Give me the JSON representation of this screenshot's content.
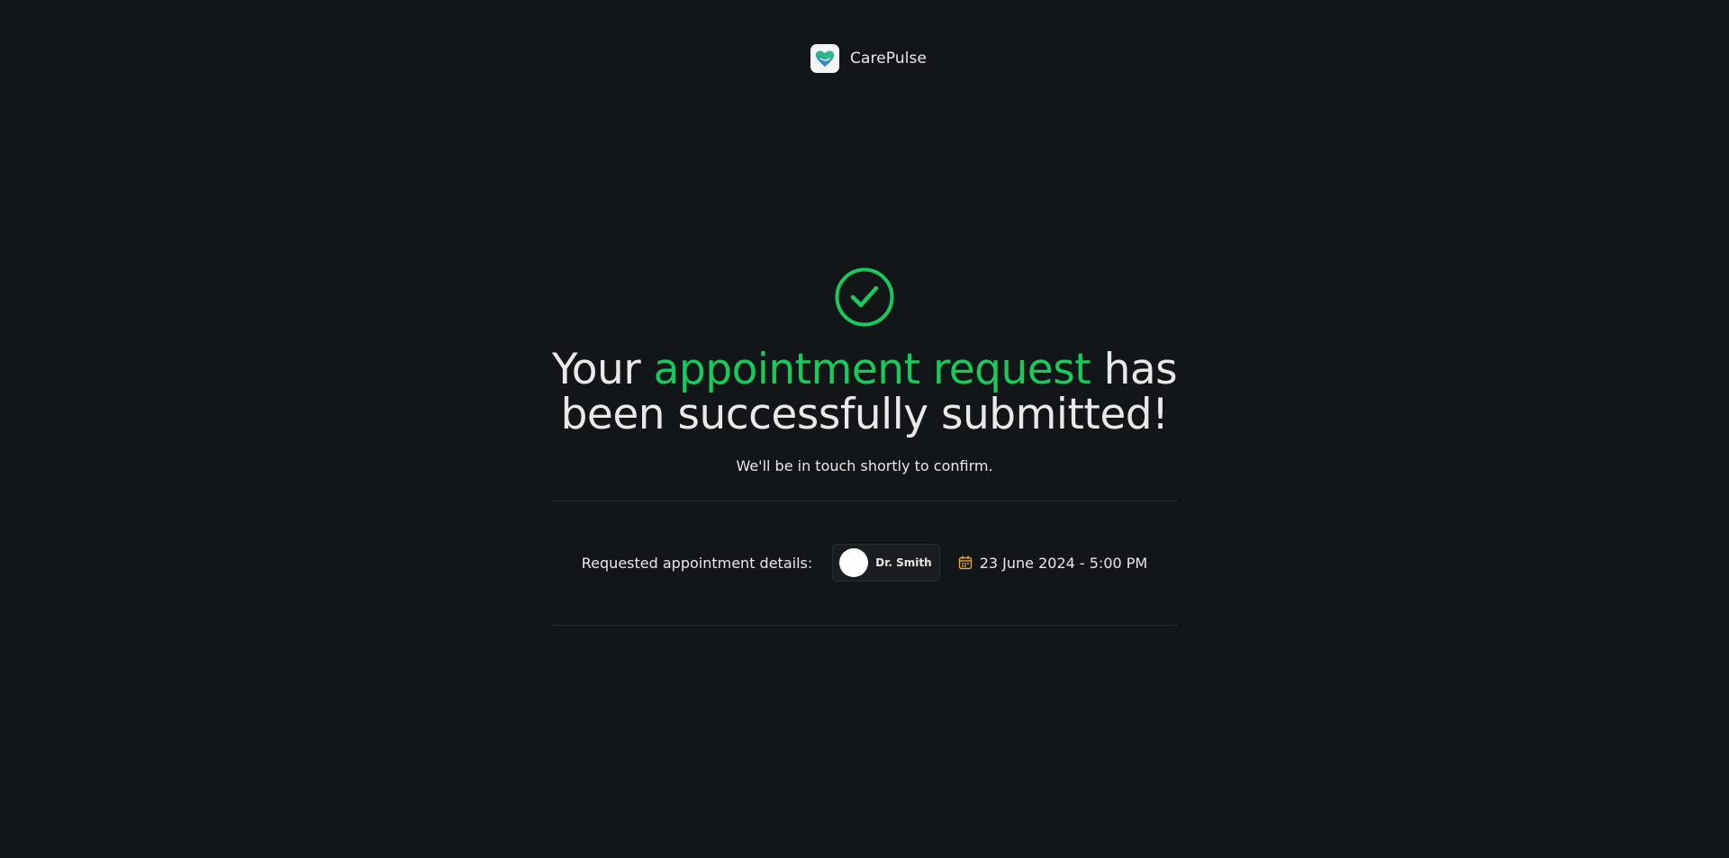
{
  "brand": {
    "name": "CarePulse"
  },
  "success": {
    "headline_pre": "Your ",
    "headline_accent": "appointment request",
    "headline_post": " has been successfully submitted!",
    "subtext": "We'll be in touch shortly to confirm."
  },
  "details": {
    "label": "Requested appointment details:",
    "doctor_name": "Dr. Smith",
    "datetime": "23 June 2024 - 5:00 PM"
  },
  "colors": {
    "background": "#131619",
    "accent_green": "#18c95c",
    "calendar_yellow": "#e8a631"
  },
  "icons": {
    "brand_logo": "heart-logo-icon",
    "success": "check-circle-icon",
    "calendar": "calendar-icon"
  }
}
